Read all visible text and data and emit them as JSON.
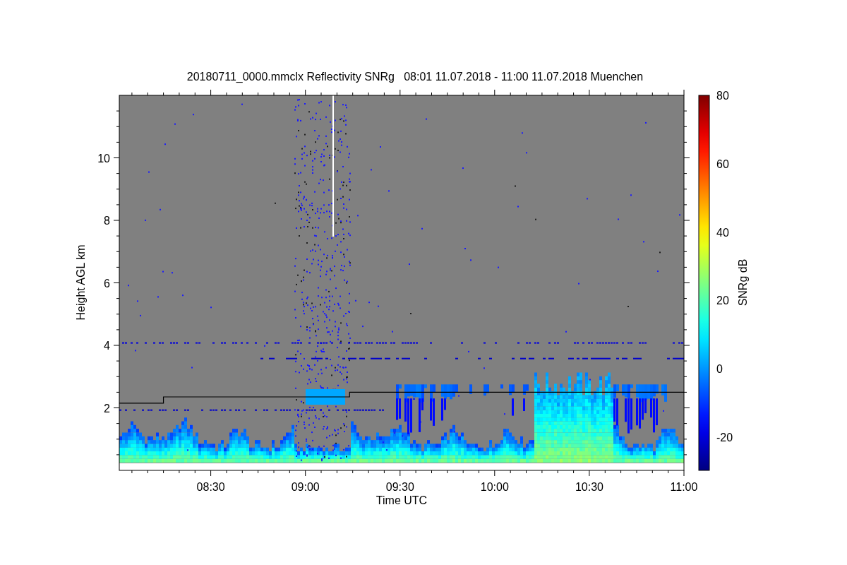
{
  "figure": {
    "title": "20180711_0000.mmclx Reflectivity SNRg   08:01 11.07.2018 - 11:00 11.07.2018 Muenchen"
  },
  "plot": {
    "xlabel": "Time UTC",
    "ylabel": "Height AGL km",
    "xticks": [
      "08:30",
      "09:00",
      "09:30",
      "10:00",
      "10:30",
      "11:00"
    ],
    "yticks": [
      "10",
      "8",
      "6",
      "4",
      "2"
    ]
  },
  "colorbar": {
    "label": "SNRg dB",
    "ticks": [
      "80",
      "60",
      "40",
      "20",
      "0",
      "-20"
    ]
  }
}
